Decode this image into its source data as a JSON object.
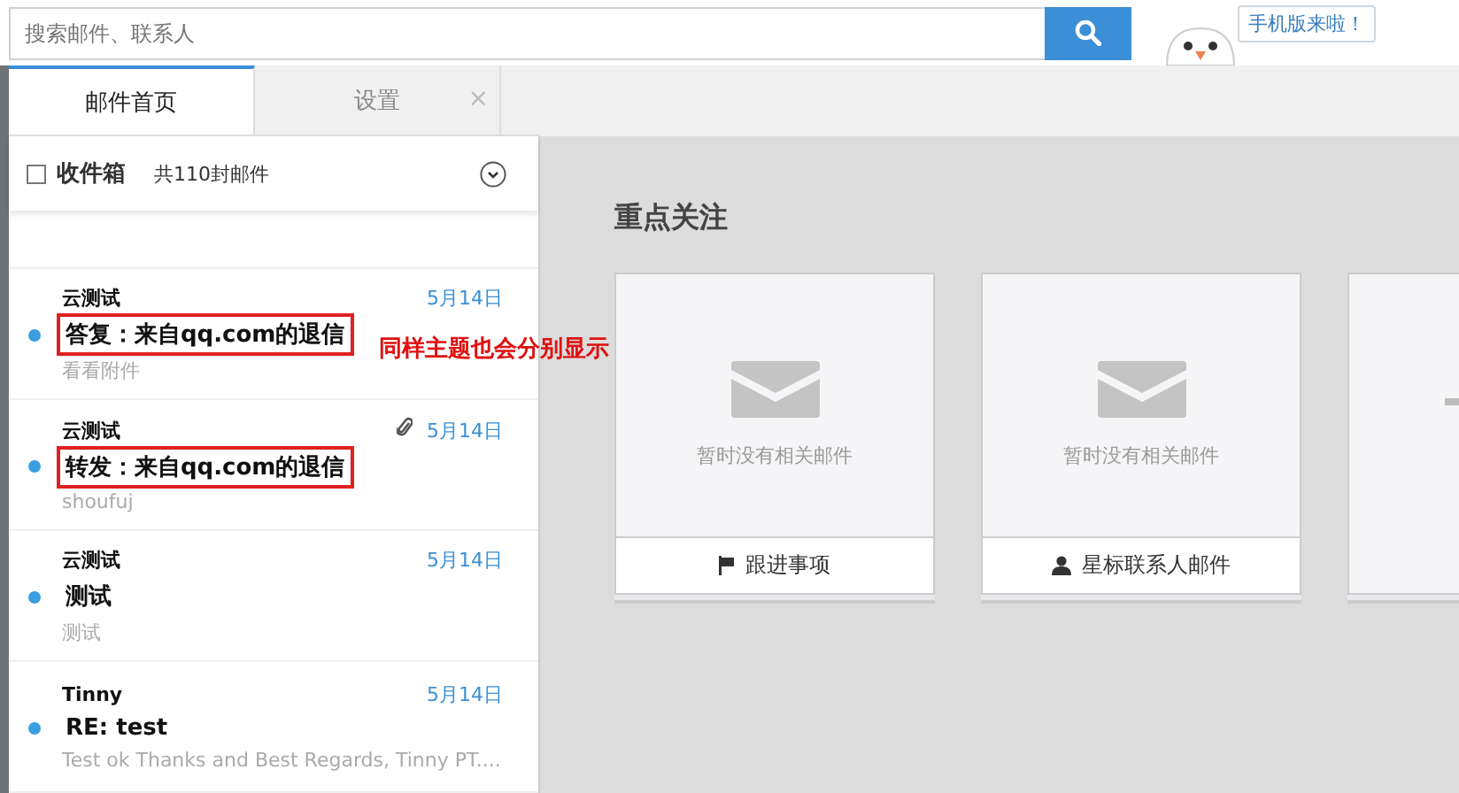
{
  "search": {
    "placeholder": "搜索邮件、联系人"
  },
  "promo_bubble": "手机版来啦！",
  "tabs": [
    {
      "label": "邮件首页",
      "selected": true
    },
    {
      "label": "设置",
      "selected": false,
      "close": "×"
    }
  ],
  "folder": {
    "name": "收件箱",
    "count": "共110封邮件",
    "checked": false
  },
  "messages": [
    {
      "sender": "云测试",
      "date": "5月14日",
      "subject": "答复：来自qq.com的退信",
      "preview": "看看附件",
      "unread": true,
      "attachment": false,
      "highlighted": true
    },
    {
      "sender": "云测试",
      "date": "5月14日",
      "subject": "转发：来自qq.com的退信",
      "preview": "shoufuj",
      "unread": true,
      "attachment": true,
      "highlighted": true
    },
    {
      "sender": "云测试",
      "date": "5月14日",
      "subject": "测试",
      "preview": "测试",
      "unread": true,
      "attachment": false,
      "highlighted": false
    },
    {
      "sender": "Tinny",
      "date": "5月14日",
      "subject": "RE: test",
      "preview": "Test ok Thanks and Best Regards, Tinny PT....",
      "unread": true,
      "attachment": false,
      "highlighted": false
    }
  ],
  "annotation": "同样主题也会分别显示",
  "focus": {
    "title": "重点关注",
    "cards": [
      {
        "kind": "list",
        "empty_text": "暂时没有相关邮件",
        "footer": "跟进事项"
      },
      {
        "kind": "list",
        "empty_text": "暂时没有相关邮件",
        "footer": "星标联系人邮件"
      },
      {
        "kind": "add"
      }
    ]
  }
}
